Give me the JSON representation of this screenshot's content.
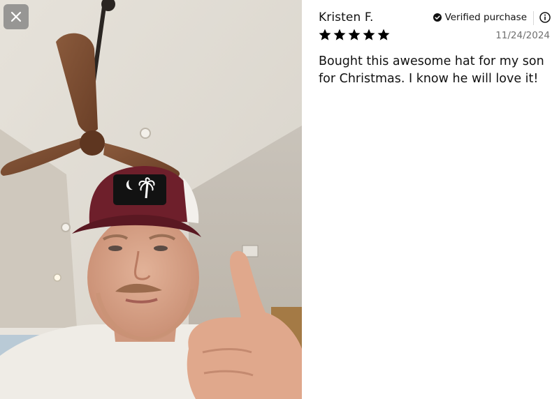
{
  "photo": {
    "alt": "Customer photo",
    "close_icon": "close-icon"
  },
  "review": {
    "reviewer_name": "Kristen F.",
    "verified_label": "Verified purchase",
    "verified_icon": "check-circle-icon",
    "info_icon": "info-icon",
    "rating": 5,
    "rating_max": 5,
    "date": "11/24/2024",
    "body": "Bought this awesome hat for my son for Christmas. I know he will love it!"
  },
  "colors": {
    "star": "#000000",
    "date": "#707070",
    "text": "#111111",
    "hat": "#6e1f2b"
  }
}
